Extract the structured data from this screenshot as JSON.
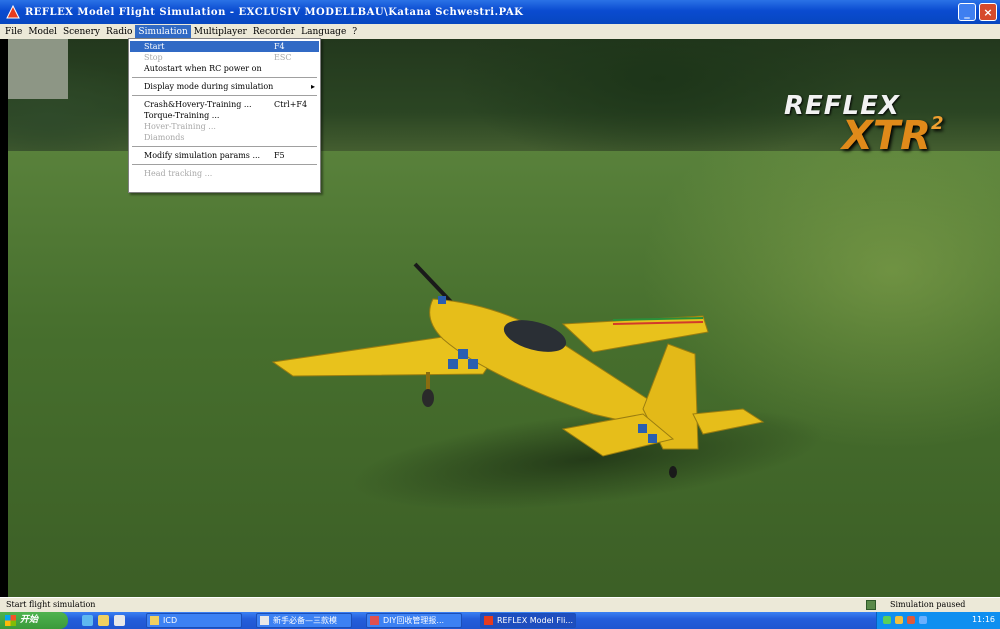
{
  "window": {
    "title": "REFLEX Model Flight Simulation - EXCLUSIV MODELLBAU\\Katana Schwestri.PAK",
    "minimize": "_",
    "close": "×"
  },
  "menubar": {
    "items": [
      "File",
      "Model",
      "Scenery",
      "Radio",
      "Simulation",
      "Multiplayer",
      "Recorder",
      "Language",
      "?"
    ]
  },
  "simulation_menu": {
    "items": [
      {
        "label": "Start",
        "shortcut": "F4"
      },
      {
        "label": "Stop",
        "shortcut": "ESC"
      },
      {
        "label": "Autostart when RC power on",
        "shortcut": ""
      },
      {
        "label": "Display mode during simulation",
        "shortcut": ""
      },
      {
        "label": "Crash&Hovery-Training ...",
        "shortcut": "Ctrl+F4"
      },
      {
        "label": "Torque-Training ...",
        "shortcut": ""
      },
      {
        "label": "Hover-Training ...",
        "shortcut": ""
      },
      {
        "label": "Diamonds",
        "shortcut": ""
      },
      {
        "label": "Modify simulation params ...",
        "shortcut": "F5"
      },
      {
        "label": "Head tracking ...",
        "shortcut": ""
      }
    ],
    "submenu_arrow": "▸"
  },
  "logo": {
    "line1": "REFLEX",
    "line2": "XTR",
    "sup": "2"
  },
  "statusbar": {
    "left": "Start flight simulation",
    "right": "Simulation paused"
  },
  "taskbar": {
    "start_label": "开始",
    "tasks": [
      "ICD",
      "新手必备—三款模",
      "DIY回收管理报...",
      "REFLEX Model Fli..."
    ],
    "clock": "11:16"
  },
  "colors": {
    "titlebar": "#0a4bd0",
    "menu_highlight": "#316ac5",
    "plane_yellow": "#e8c21c",
    "logo_orange": "#e08a1a"
  }
}
